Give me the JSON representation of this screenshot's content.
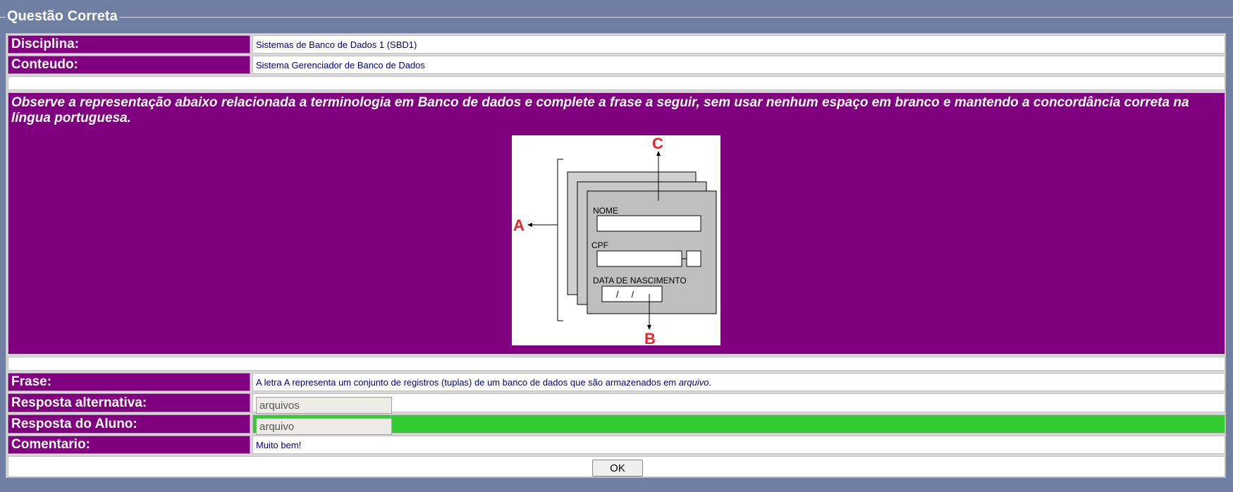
{
  "legend": "Questão Correta",
  "disciplina": {
    "label": "Disciplina:",
    "value": "Sistemas de Banco de Dados 1 (SBD1)"
  },
  "conteudo": {
    "label": "Conteudo:",
    "value": "Sistema Gerenciador de Banco de Dados"
  },
  "question": "Observe a representação abaixo relacionada a terminologia em Banco de dados e complete a frase a seguir, sem usar nenhum espaço em branco e mantendo a concordância correta na língua portuguesa.",
  "figure": {
    "label_a": "A",
    "label_b": "B",
    "label_c": "C",
    "field_nome": "NOME",
    "field_cpf": "CPF",
    "field_data": "DATA DE NASCIMENTO",
    "date_placeholder": "/     /",
    "accent_color": "#e8262c"
  },
  "frase": {
    "label": "Frase:",
    "text_before": "A letra A representa um conjunto de registros (tuplas) de um banco de dados que são armazenados em ",
    "text_italic": "arquivo",
    "text_after": "."
  },
  "resposta_alternativa": {
    "label": "Resposta alternativa:",
    "value": "arquivos"
  },
  "resposta_aluno": {
    "label": "Resposta do Aluno:",
    "value": "arquivo",
    "status_color": "#33cc33"
  },
  "comentario": {
    "label": "Comentario:",
    "value": "Muito bem!"
  },
  "ok_label": "OK"
}
